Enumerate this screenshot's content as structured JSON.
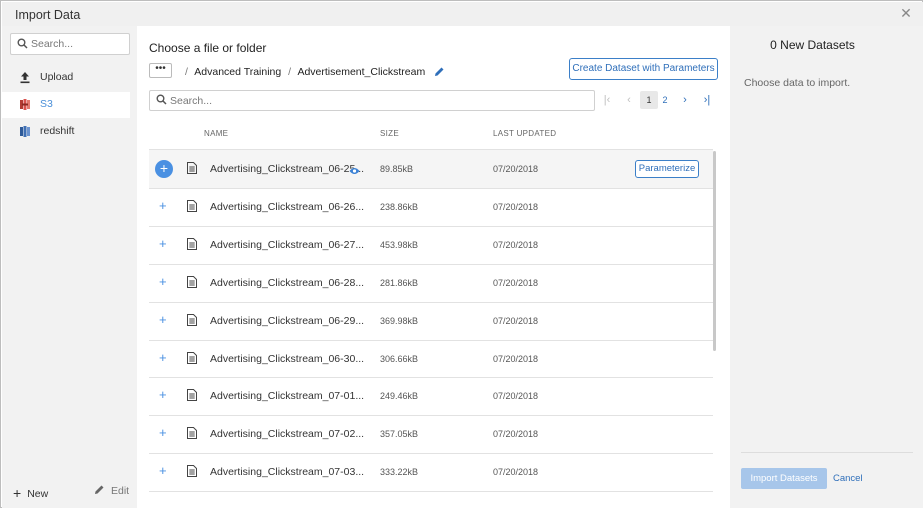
{
  "window": {
    "title": "Import Data",
    "close_icon": "close-icon"
  },
  "sidebar": {
    "search_placeholder": "Search...",
    "items": [
      {
        "label": "Upload",
        "icon": "upload-icon"
      },
      {
        "label": "S3",
        "icon": "aws-s3-icon",
        "active": true
      },
      {
        "label": "redshift",
        "icon": "redshift-icon"
      }
    ],
    "new_label": "New",
    "edit_label": "Edit"
  },
  "main": {
    "heading": "Choose a file or folder",
    "more_label": "•••",
    "breadcrumb": [
      "Advanced Training",
      "Advertisement_Clickstream"
    ],
    "create_button": "Create Dataset with Parameters",
    "search_placeholder": "Search...",
    "pagination": {
      "pages": [
        "1",
        "2"
      ],
      "current": "1"
    },
    "columns": [
      "NAME",
      "SIZE",
      "LAST UPDATED"
    ],
    "parameterize_label": "Parameterize",
    "files": [
      {
        "name": "Advertising_Clickstream_06-25...",
        "size": "89.85kB",
        "updated": "07/20/2018",
        "selected": true
      },
      {
        "name": "Advertising_Clickstream_06-26...",
        "size": "238.86kB",
        "updated": "07/20/2018"
      },
      {
        "name": "Advertising_Clickstream_06-27...",
        "size": "453.98kB",
        "updated": "07/20/2018"
      },
      {
        "name": "Advertising_Clickstream_06-28...",
        "size": "281.86kB",
        "updated": "07/20/2018"
      },
      {
        "name": "Advertising_Clickstream_06-29...",
        "size": "369.98kB",
        "updated": "07/20/2018"
      },
      {
        "name": "Advertising_Clickstream_06-30...",
        "size": "306.66kB",
        "updated": "07/20/2018"
      },
      {
        "name": "Advertising_Clickstream_07-01...",
        "size": "249.46kB",
        "updated": "07/20/2018"
      },
      {
        "name": "Advertising_Clickstream_07-02...",
        "size": "357.05kB",
        "updated": "07/20/2018"
      },
      {
        "name": "Advertising_Clickstream_07-03...",
        "size": "333.22kB",
        "updated": "07/20/2018"
      }
    ]
  },
  "right_panel": {
    "title": "0 New Datasets",
    "message": "Choose data to import.",
    "import_button": "Import Datasets",
    "cancel_label": "Cancel"
  },
  "colors": {
    "accent": "#4a90e2",
    "link": "#2f6fba",
    "panel_bg": "#f2f2f2",
    "import_disabled": "#a7c6ea",
    "s3_icon": "#d9534f",
    "redshift_icon": "#3f6fb3"
  }
}
